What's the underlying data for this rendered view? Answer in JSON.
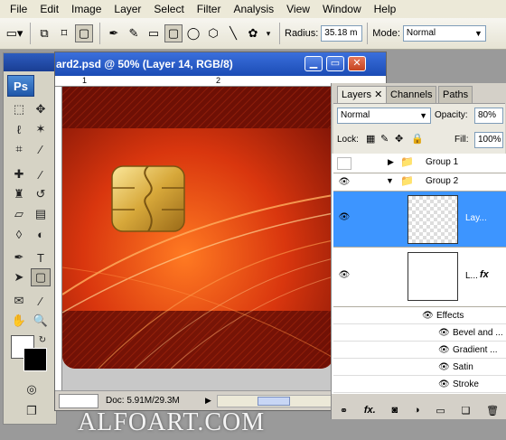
{
  "menu": [
    "File",
    "Edit",
    "Image",
    "Layer",
    "Select",
    "Filter",
    "Analysis",
    "View",
    "Window",
    "Help"
  ],
  "options": {
    "radius_label": "Radius:",
    "radius_value": "35.18 m",
    "mode_label": "Mode:",
    "mode_value": "Normal"
  },
  "document": {
    "title": "ard2.psd @ 50% (Layer 14, RGB/8)",
    "ruler_marks": [
      "1",
      "2"
    ],
    "status": "Doc: 5.91M/29.3M"
  },
  "toolbox": {
    "logo": "Ps"
  },
  "layers_panel": {
    "tabs": [
      "Layers",
      "Channels",
      "Paths"
    ],
    "blend_mode": "Normal",
    "opacity_label": "Opacity:",
    "opacity_value": "80%",
    "lock_label": "Lock:",
    "fill_label": "Fill:",
    "fill_value": "100%",
    "groups": [
      "Group 1",
      "Group 2"
    ],
    "layers": [
      "Lay...",
      "L..."
    ],
    "effects_label": "Effects",
    "effects": [
      "Bevel and ...",
      "Gradient ...",
      "Satin",
      "Stroke"
    ]
  },
  "watermark": "ALFOART.COM"
}
